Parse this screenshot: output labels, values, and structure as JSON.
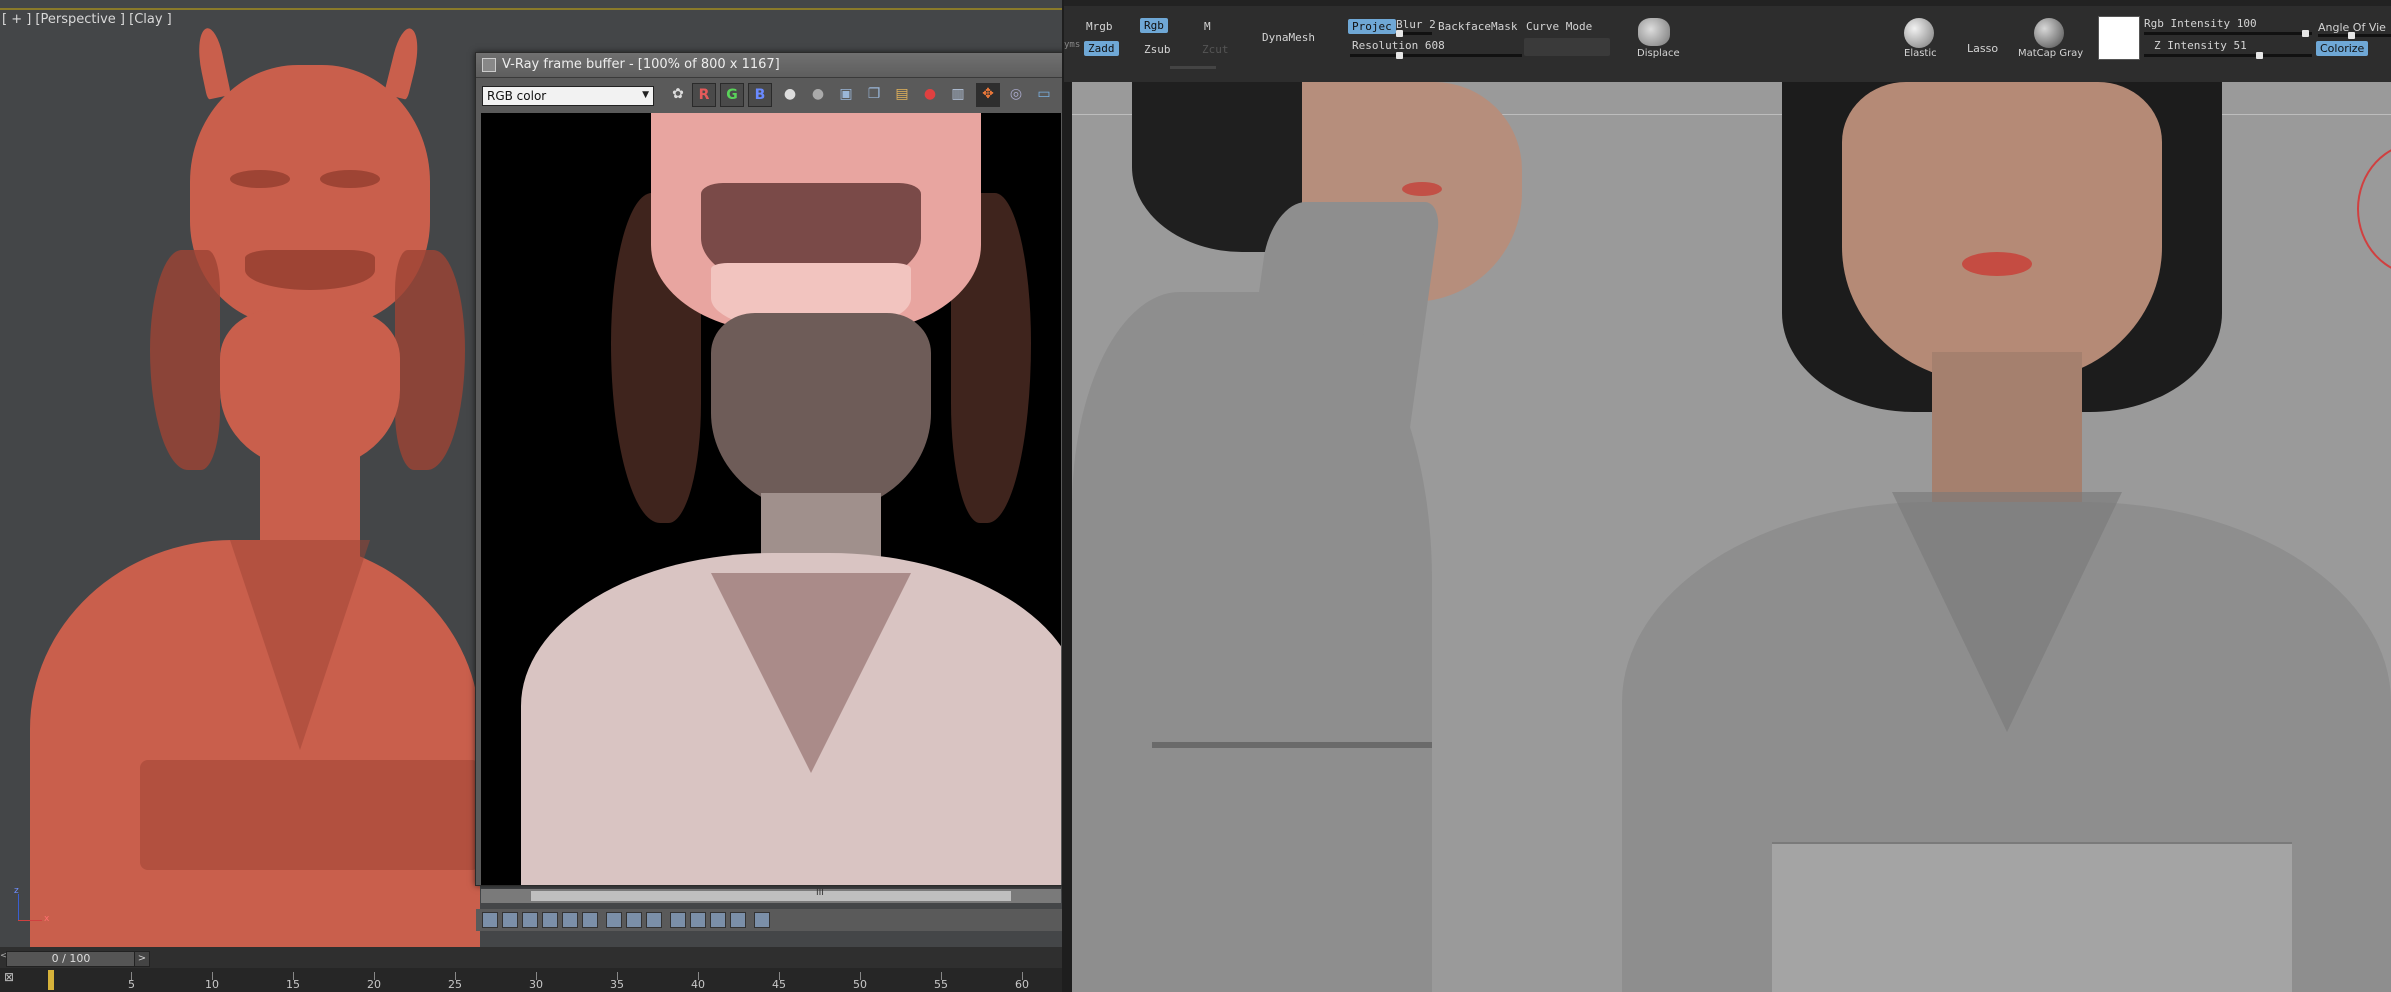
{
  "max": {
    "viewport_label": "[ + ] [Perspective ] [Clay ]",
    "axis_labels": {
      "z": "z",
      "x": "x"
    }
  },
  "vfb": {
    "title": "V-Ray frame buffer - [100% of 800 x 1167]",
    "channel": "RGB color",
    "channel_buttons": [
      "R",
      "G",
      "B"
    ],
    "scroll_grip": "III"
  },
  "timeline": {
    "frame": "0 / 100",
    "next": ">",
    "prev": "<",
    "ticks": [
      "5",
      "10",
      "15",
      "20",
      "25",
      "30",
      "35",
      "40",
      "45",
      "50",
      "55",
      "60"
    ]
  },
  "zbrush": {
    "mrgb": "Mrgb",
    "rgb": "Rgb",
    "m": "M",
    "zadd": "Zadd",
    "zsub": "Zsub",
    "zcut": "Zcut",
    "dynamesh": "DynaMesh",
    "project": "Projec",
    "blur": "Blur 2",
    "backface": "BackfaceMask",
    "curve": "Curve Mode",
    "resolution": "Resolution 608",
    "displace": "Displace",
    "elastic": "Elastic",
    "lasso": "Lasso",
    "matcap": "MatCap Gray",
    "rgb_intensity": "Rgb Intensity 100",
    "z_intensity": "Z Intensity 51",
    "angle": "Angle Of Vie",
    "colorize": "Colorize",
    "partial": "yms"
  },
  "colors": {
    "accent": "#6fa8d6",
    "clay": "#c95f4c",
    "timeline_key": "#d6b23a"
  }
}
